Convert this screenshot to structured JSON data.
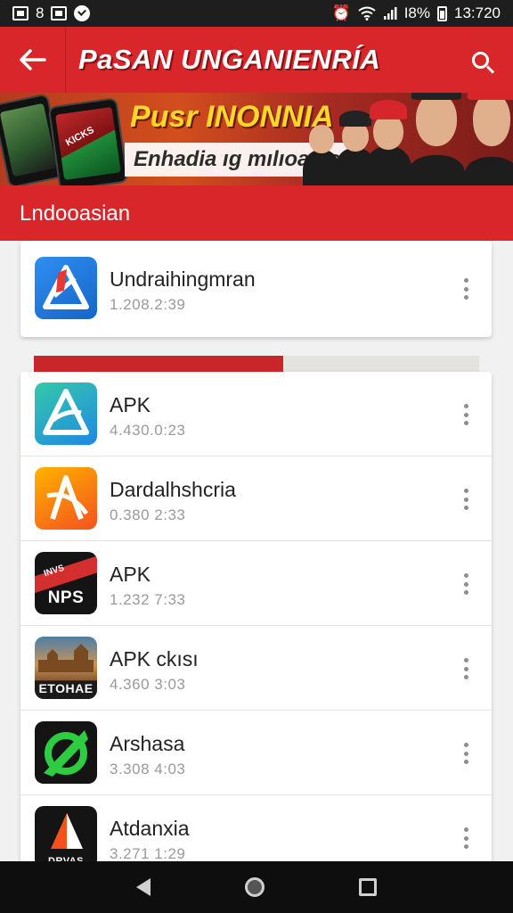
{
  "status_bar": {
    "left_text": "8",
    "battery_text": "I8%",
    "time": "13:720"
  },
  "app_bar": {
    "title": "PaSAN UNGANIENRÍA"
  },
  "banner": {
    "title": "Pusr INONNIA",
    "subtitle": "Enhadia ıg mılıoad s",
    "phone_label": "KICKS"
  },
  "section": {
    "title": "Lndooasian"
  },
  "featured": {
    "name": "Undraihingmran",
    "meta": "1.208.2:39"
  },
  "apps": [
    {
      "name": "APK",
      "meta": "4.430.0:23",
      "icon": "blue-triangle-logo-icon"
    },
    {
      "name": "Dardalhshcria",
      "meta": "0.380 2:33",
      "icon": "orange-a-logo-icon"
    },
    {
      "name": "APK",
      "meta": "1.232 7:33",
      "icon": "black-nps-logo-icon",
      "icon_text": "NPS",
      "icon_band_text": "INVS"
    },
    {
      "name": "APK ckısı",
      "meta": "4.360 3:03",
      "icon": "landmark-photo-icon",
      "icon_text": "ETOHAE"
    },
    {
      "name": "Arshasa",
      "meta": "3.308 4:03",
      "icon": "green-swirl-logo-icon"
    },
    {
      "name": "Atdanxia",
      "meta": "3.271 1:29",
      "icon": "black-sail-logo-icon",
      "icon_text": "DRVAS"
    }
  ],
  "colors": {
    "primary": "#d9262a",
    "status_bar": "#1e1e1e",
    "nav_bar": "#0e0e0e",
    "banner_title": "#ffd829"
  }
}
